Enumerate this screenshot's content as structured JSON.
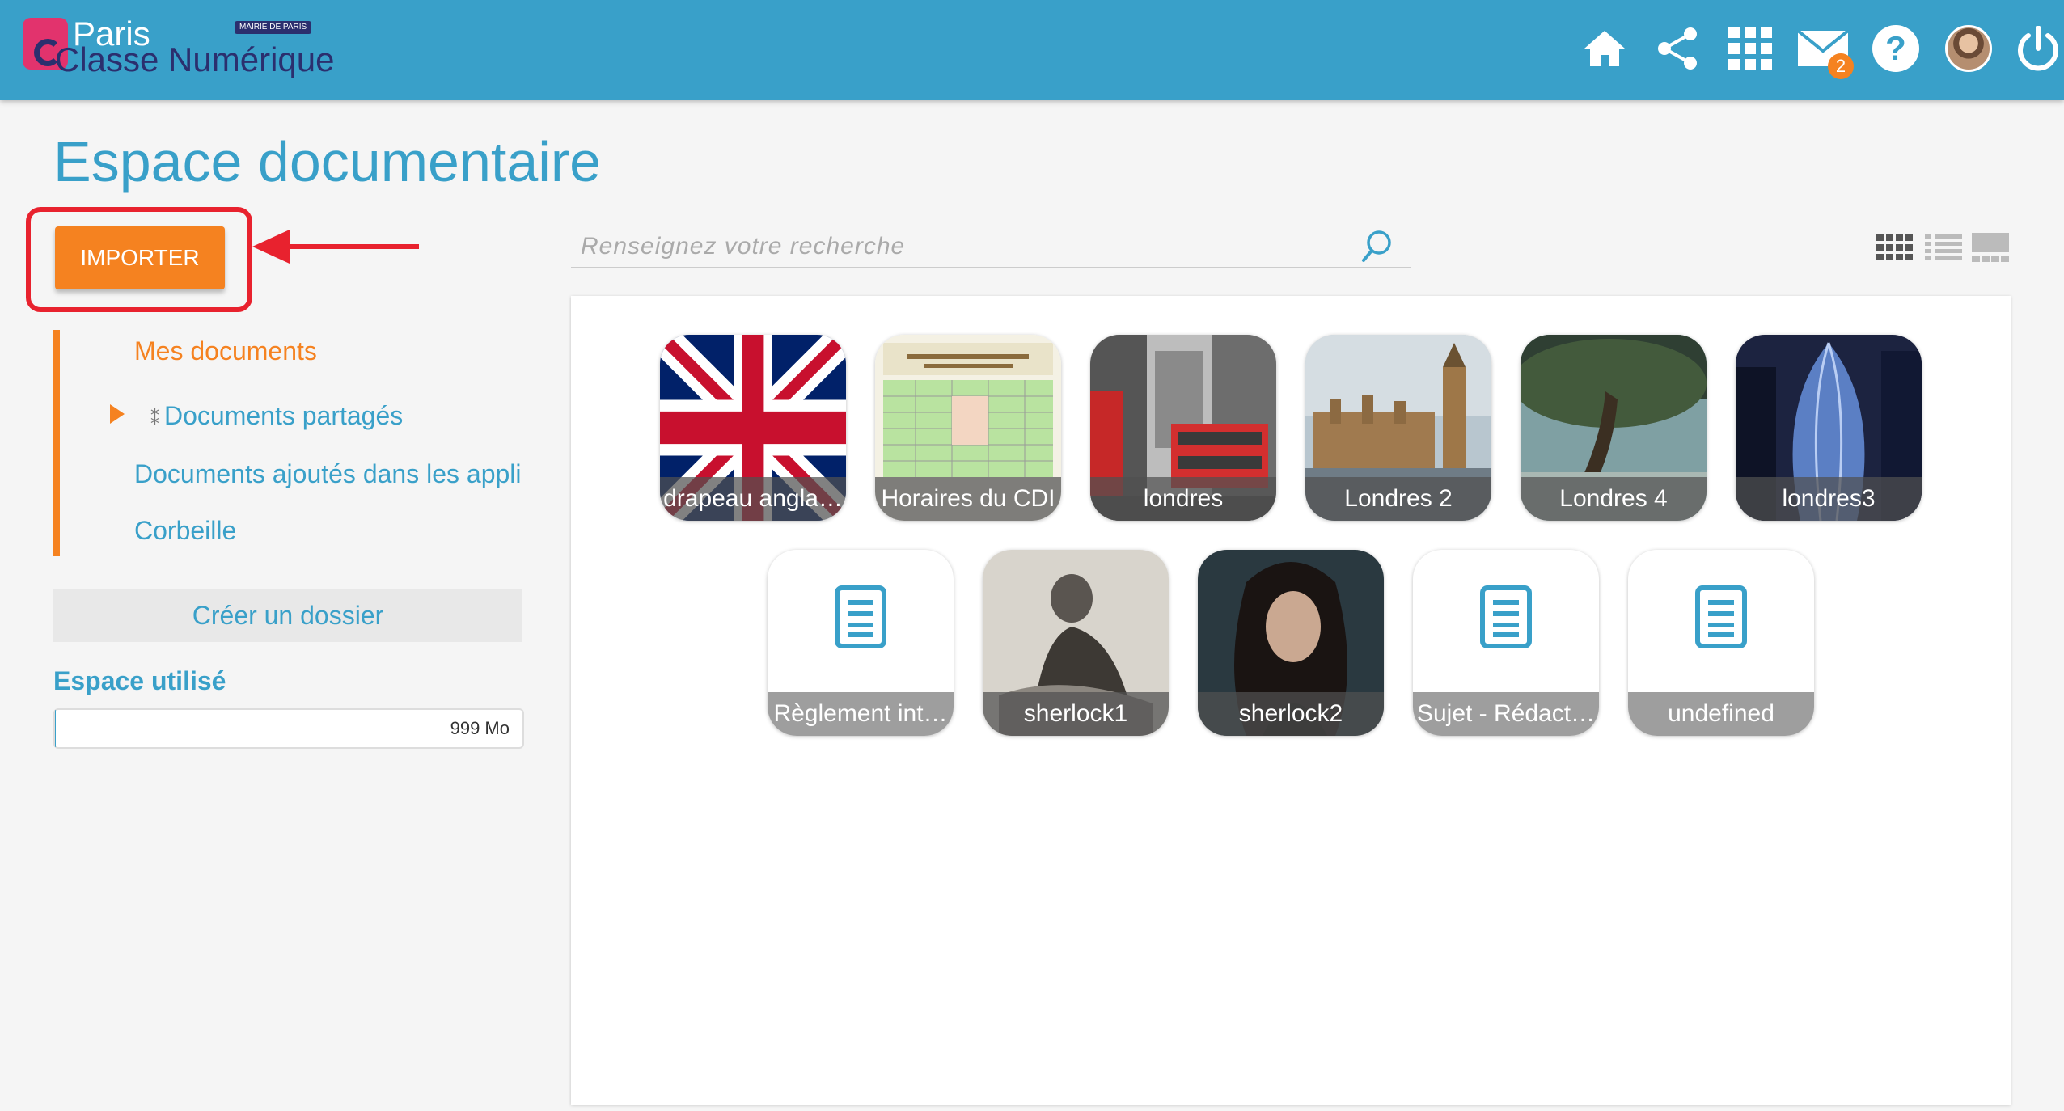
{
  "header": {
    "logo_top": "Paris",
    "logo_bottom": "Classe Numérique",
    "mairie": "MAIRIE DE PARIS",
    "nav_icons": [
      "home-icon",
      "share-icon",
      "apps-grid-icon",
      "mail-icon",
      "help-icon",
      "avatar",
      "power-icon"
    ],
    "mail_badge": "2"
  },
  "page": {
    "title": "Espace documentaire",
    "import_button": "IMPORTER",
    "create_folder": "Créer un dossier"
  },
  "sidebar": {
    "items": [
      {
        "label": "Mes documents",
        "active": true
      },
      {
        "label": "Documents partagés",
        "active": false
      },
      {
        "label": "Documents ajoutés dans les appli",
        "active": false
      },
      {
        "label": "Corbeille",
        "active": false
      }
    ]
  },
  "storage": {
    "label": "Espace utilisé",
    "value": "999 Mo",
    "fraction": 0.002
  },
  "search": {
    "placeholder": "Renseignez votre recherche",
    "value": ""
  },
  "view_modes": [
    "icons-view",
    "list-view",
    "carousel-view"
  ],
  "files": [
    {
      "name": "drapeau angla…",
      "kind": "image",
      "thumb": "union-jack"
    },
    {
      "name": "Horaires du CDI",
      "kind": "image",
      "thumb": "schedule"
    },
    {
      "name": "londres",
      "kind": "image",
      "thumb": "bus-street"
    },
    {
      "name": "Londres 2",
      "kind": "image",
      "thumb": "parliament"
    },
    {
      "name": "Londres 4",
      "kind": "image",
      "thumb": "tree"
    },
    {
      "name": "londres3",
      "kind": "image",
      "thumb": "gherkin"
    },
    {
      "name": "Règlement int…",
      "kind": "document",
      "thumb": "document-icon"
    },
    {
      "name": "sherlock1",
      "kind": "image",
      "thumb": "engraving"
    },
    {
      "name": "sherlock2",
      "kind": "image",
      "thumb": "portrait"
    },
    {
      "name": "Sujet - Rédact…",
      "kind": "document",
      "thumb": "document-icon"
    },
    {
      "name": "undefined",
      "kind": "document",
      "thumb": "document-icon"
    }
  ],
  "colors": {
    "header": "#39a0c9",
    "accent": "#f58220",
    "title": "#39a0c9",
    "highlight": "#e8222e"
  }
}
